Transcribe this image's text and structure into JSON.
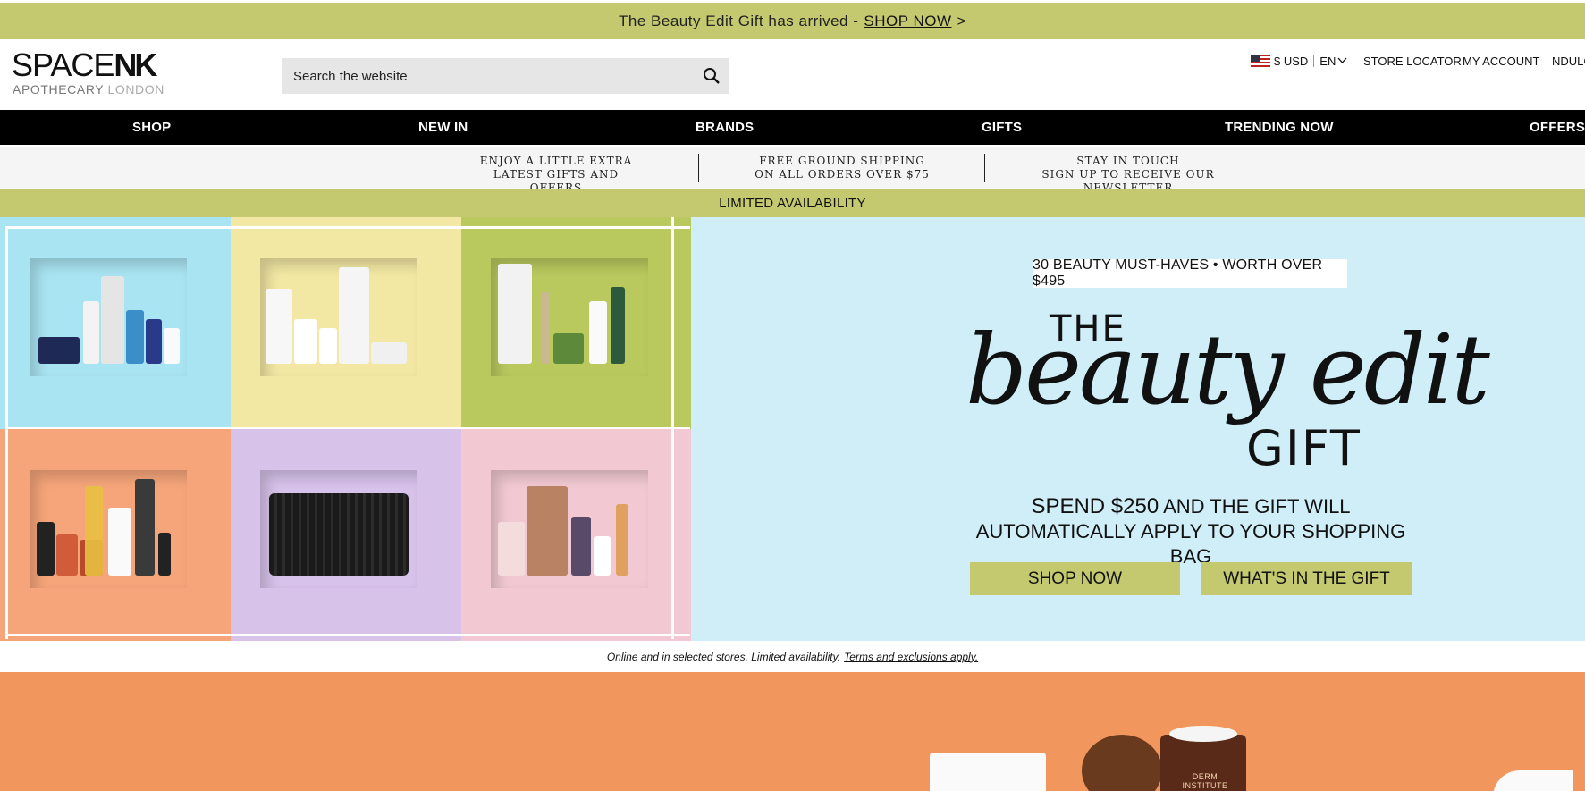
{
  "promo": {
    "text": "The Beauty Edit Gift has arrived -",
    "link": "SHOP NOW",
    "arrow": ">"
  },
  "header": {
    "logo_part1": "SPACE",
    "logo_part2": "NK",
    "logo_sub1": "APOTHECARY",
    "logo_sub2": "LONDON",
    "search_placeholder": "Search the website",
    "currency": "$ USD",
    "language": "EN",
    "store_locator": "STORE LOCATOR",
    "my_account": "MY ACCOUNT",
    "nduluge": "NDULG"
  },
  "nav": [
    "SHOP",
    "NEW IN",
    "BRANDS",
    "GIFTS",
    "TRENDING NOW",
    "OFFERS"
  ],
  "benefits": [
    {
      "line1": "ENJOY A LITTLE EXTRA",
      "line2": "LATEST GIFTS AND OFFERS"
    },
    {
      "line1": "FREE GROUND SHIPPING",
      "line2": "ON ALL ORDERS OVER $75"
    },
    {
      "line1": "STAY IN TOUCH",
      "line2": "SIGN UP TO RECEIVE OUR NEWSLETTER"
    }
  ],
  "limited": "LIMITED AVAILABILITY",
  "hero": {
    "pill": "30 BEAUTY MUST-HAVES • WORTH OVER $495",
    "the": "THE",
    "beauty_edit": "beauty edit",
    "gift": "GIFT",
    "spend_big": "SPEND $250",
    "spend_rest": "AND THE GIFT WILL",
    "spend_line2": "AUTOMATICALLY APPLY TO YOUR SHOPPING BAG",
    "btn_shop": "SHOP NOW",
    "btn_whats": "WHAT'S IN THE GIFT",
    "tile_colors": [
      "#a9e4f2",
      "#f2e7a3",
      "#b9c95e",
      "#f6a57a",
      "#d7c2ea",
      "#f2c9d2"
    ]
  },
  "disclaimer": {
    "text": "Online and in selected stores. Limited availability.",
    "link": "Terms and exclusions apply."
  },
  "product_label": "DERM INSTITUTE"
}
